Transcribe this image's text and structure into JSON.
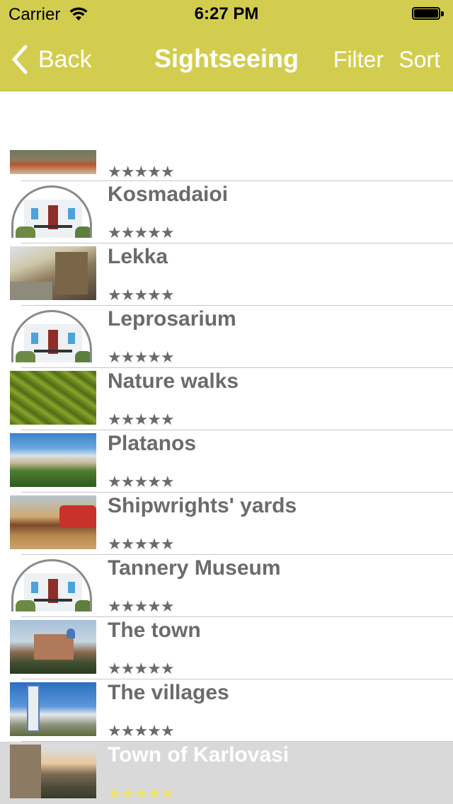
{
  "status_bar": {
    "carrier": "Carrier",
    "time": "6:27 PM",
    "battery_level": 1.0
  },
  "nav": {
    "back_label": "Back",
    "title": "Sightseeing",
    "filter_label": "Filter",
    "sort_label": "Sort"
  },
  "colors": {
    "accent": "#d3cd4f",
    "selected_row": "#d9d9d9",
    "text_gray": "#6b6b6b"
  },
  "star_glyphs": "★★★★★",
  "list": {
    "items": [
      {
        "title": "",
        "rating": 0,
        "thumbnail": "rooftops-photo",
        "selected": false
      },
      {
        "title": "Kosmadaioi",
        "rating": 0,
        "thumbnail": "house-placeholder-icon",
        "selected": false
      },
      {
        "title": "Lekka",
        "rating": 0,
        "thumbnail": "village-street-photo",
        "selected": false
      },
      {
        "title": "Leprosarium",
        "rating": 0,
        "thumbnail": "house-placeholder-icon",
        "selected": false
      },
      {
        "title": "Nature walks",
        "rating": 0,
        "thumbnail": "green-foliage-photo",
        "selected": false
      },
      {
        "title": "Platanos",
        "rating": 0,
        "thumbnail": "hillside-village-photo",
        "selected": false
      },
      {
        "title": "Shipwrights' yards",
        "rating": 0,
        "thumbnail": "boatyard-photo",
        "selected": false
      },
      {
        "title": "Tannery Museum",
        "rating": 0,
        "thumbnail": "house-placeholder-icon",
        "selected": false
      },
      {
        "title": "The town",
        "rating": 0,
        "thumbnail": "church-town-photo",
        "selected": false
      },
      {
        "title": "The villages",
        "rating": 0,
        "thumbnail": "bell-tower-photo",
        "selected": false
      },
      {
        "title": "Town of Karlovasi",
        "rating": 0,
        "thumbnail": "karlovasi-photo",
        "selected": true
      }
    ]
  }
}
